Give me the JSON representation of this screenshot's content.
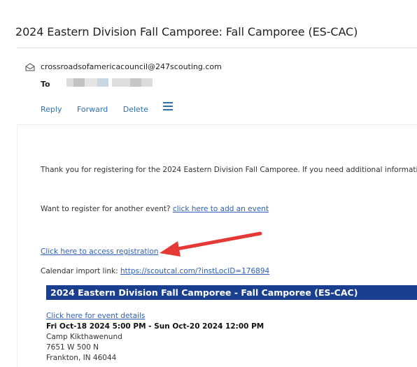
{
  "email": {
    "subject": "2024 Eastern Division Fall Camporee: Fall Camporee (ES-CAC)",
    "sender": "crossroadsofamericacouncil@247scouting.com",
    "to_label": "To"
  },
  "actions": {
    "reply": "Reply",
    "forward": "Forward",
    "delete": "Delete",
    "more_icon": "hamburger-menu-icon"
  },
  "body": {
    "intro": "Thank you for registering for the 2024 Eastern Division Fall Camporee. If you need additional information",
    "another_prefix": "Want to register for another event? ",
    "another_link": "click here to add an event",
    "access_link": "Click here to access registration",
    "calendar_prefix": "Calendar import link: ",
    "calendar_link": "https://scoutcal.com/?instLocID=176894"
  },
  "event": {
    "banner_title": "2024 Eastern Division Fall Camporee - Fall Camporee (ES-CAC)",
    "details_link": "Click here for event details",
    "dates": "Fri Oct-18 2024 5:00 PM - Sun Oct-20 2024 12:00 PM",
    "location_name": "Camp Kikthawenund",
    "address_line1": "7651 W 500 N",
    "address_line2": "Frankton, IN 46044"
  },
  "colors": {
    "banner": "#1a3f8f",
    "link": "#2f5fb7",
    "annotation_arrow": "#e53935"
  }
}
